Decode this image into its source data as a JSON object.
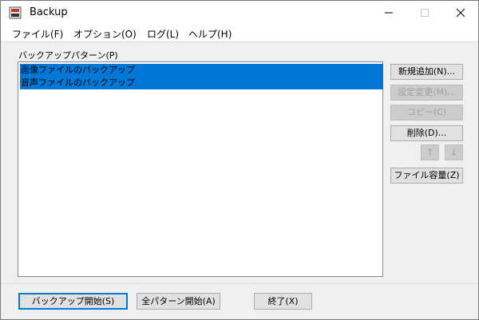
{
  "window": {
    "title": "Backup"
  },
  "icons": {
    "app": "backup-app-icon",
    "minimize": "minimize-icon",
    "maximize": "maximize-icon",
    "close": "close-icon",
    "up": "arrow-up-icon",
    "down": "arrow-down-icon"
  },
  "menu": {
    "items": [
      {
        "label": "ファイル(F)"
      },
      {
        "label": "オプション(O)"
      },
      {
        "label": "ログ(L)"
      },
      {
        "label": "ヘルプ(H)"
      }
    ]
  },
  "patterns": {
    "label": "バックアップパターン(P)",
    "items": [
      {
        "label": "画像ファイルのバックアップ",
        "selected": true
      },
      {
        "label": "音声ファイルのバックアップ",
        "selected": true
      }
    ]
  },
  "side_buttons": {
    "add": "新規追加(N)...",
    "edit": "設定変更(M)...",
    "copy": "コピー(C)",
    "delete": "削除(D)...",
    "up": "↑",
    "down": "↓",
    "file_size": "ファイル容量(Z)"
  },
  "bottom_buttons": {
    "start": "バックアップ開始(S)",
    "start_all": "全パターン開始(A)",
    "exit": "終了(X)"
  },
  "colors": {
    "selection": "#0078d7",
    "accent": "#0078d7"
  }
}
